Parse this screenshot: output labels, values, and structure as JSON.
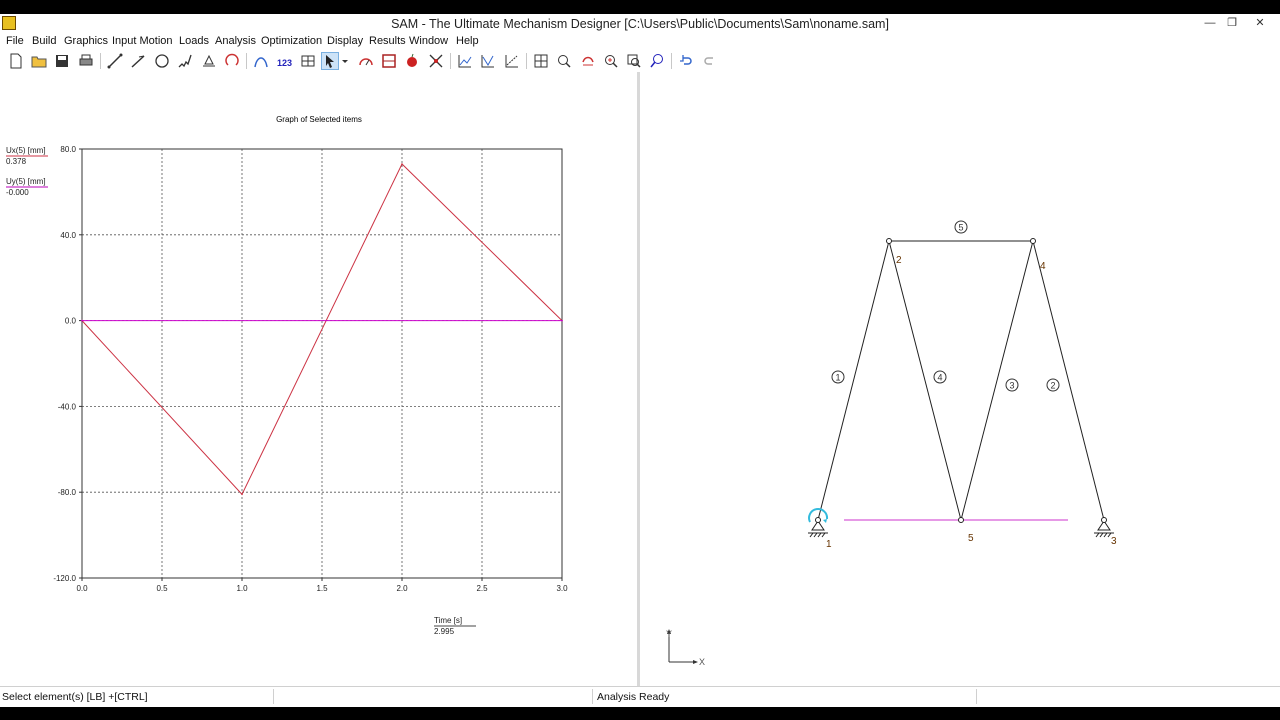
{
  "window": {
    "title": "SAM - The Ultimate Mechanism Designer [C:\\Users\\Public\\Documents\\Sam\\noname.sam]",
    "controls": {
      "minimize": "—",
      "restore": "❐",
      "close": "✕"
    }
  },
  "menu": [
    "File",
    "Build",
    "Graphics",
    "Input Motion",
    "Loads",
    "Analysis",
    "Optimization",
    "Display",
    "Results",
    "Window",
    "Help"
  ],
  "toolbar": {
    "icons": [
      "new-file-icon",
      "open-folder-icon",
      "save-icon",
      "print-icon",
      "line-element-icon",
      "element-icon",
      "circle-element-icon",
      "spring-element-icon",
      "support-icon",
      "rotate-input-icon",
      "bezier-icon",
      "numbering-icon",
      "grid-icon",
      "select-arrow-icon",
      "dropdown-icon",
      "speedometer-icon",
      "film-icon",
      "apple-icon",
      "windmill-icon",
      "graph-icon",
      "graph-grid-icon",
      "graph-dashed-icon",
      "fit-frame-icon",
      "zoom-out-icon",
      "pan-icon",
      "zoom-in-icon",
      "zoom-window-icon",
      "zoom-all-icon",
      "undo-icon",
      "redo-icon"
    ]
  },
  "graph": {
    "legend": [
      {
        "label": "Ux(5) [mm]",
        "value": "0.378",
        "color": "#cc3344"
      },
      {
        "label": "Uy(5) [mm]",
        "value": "-0.000",
        "color": "#bb00bb"
      }
    ],
    "x_readout": {
      "label": "Time [s]",
      "value": "2.995"
    }
  },
  "chart_data": {
    "type": "line",
    "title": "Graph of Selected items",
    "xlabel": "Time [s]",
    "ylabel": "",
    "xlim": [
      0,
      3
    ],
    "ylim": [
      -120,
      80
    ],
    "x_ticks": [
      "0.0",
      "0.5",
      "1.0",
      "1.5",
      "2.0",
      "2.5",
      "3.0"
    ],
    "y_ticks": [
      "80.0",
      "40.0",
      "0.0",
      "-40.0",
      "-80.0",
      "-120.0"
    ],
    "x_tick_values": [
      0,
      0.5,
      1.0,
      1.5,
      2.0,
      2.5,
      3.0
    ],
    "y_tick_values": [
      80,
      40,
      0,
      -40,
      -80,
      -120
    ],
    "grid": true,
    "series": [
      {
        "name": "Ux(5) [mm]",
        "color": "#cc3344",
        "x": [
          0,
          1,
          2,
          3
        ],
        "y": [
          0,
          -81,
          73,
          0
        ]
      },
      {
        "name": "Uy(5) [mm]",
        "color": "#cc00cc",
        "x": [
          0,
          3
        ],
        "y": [
          0,
          0
        ]
      }
    ]
  },
  "mechanism": {
    "element_labels": [
      "5",
      "1",
      "4",
      "3",
      "2"
    ],
    "node_labels": [
      "1",
      "2",
      "3",
      "4",
      "5"
    ],
    "axes": {
      "x": "X",
      "y": "Y"
    }
  },
  "status": {
    "left": "Select element(s) [LB] +[CTRL]",
    "middle": "Analysis Ready"
  }
}
